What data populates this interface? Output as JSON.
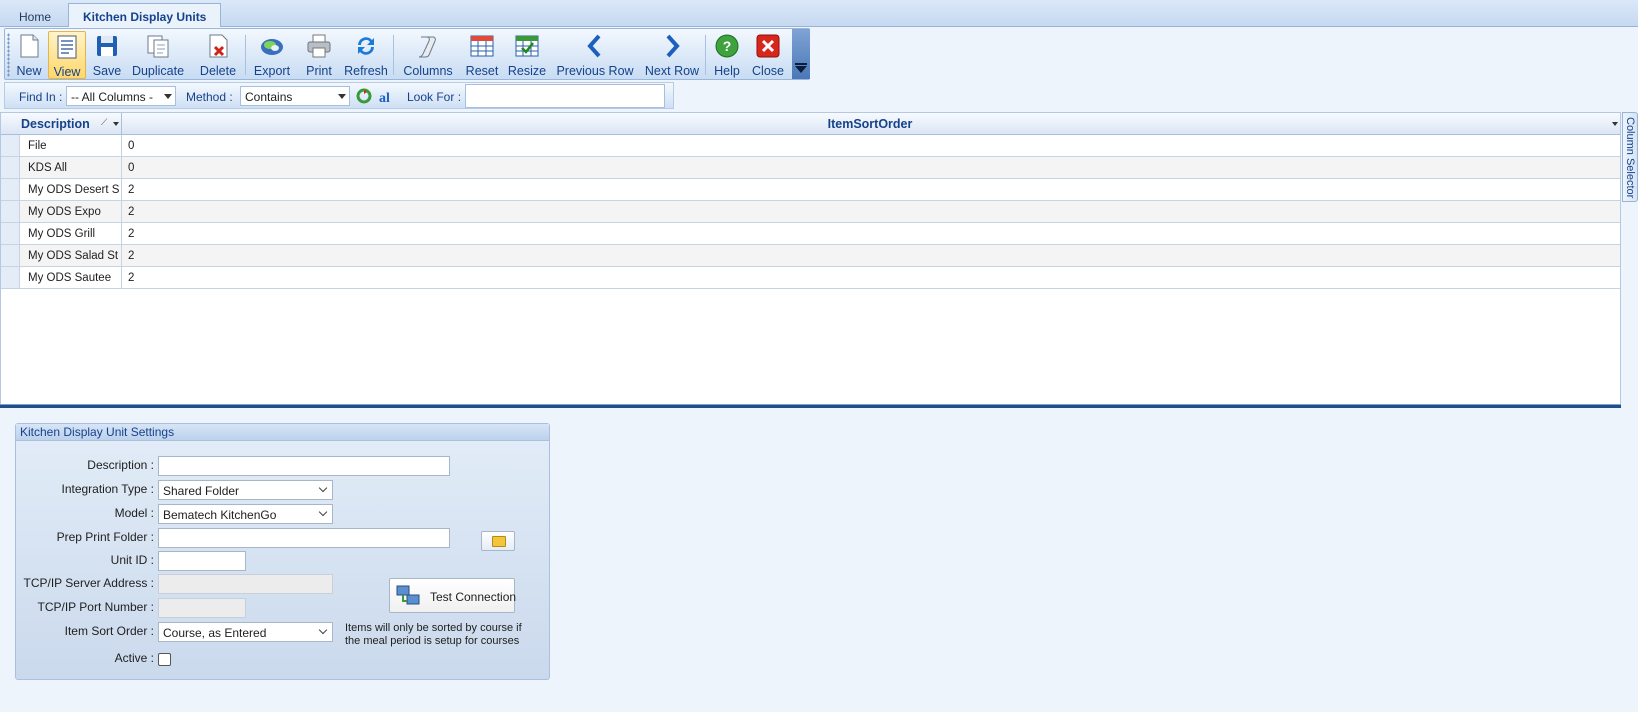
{
  "tabs": [
    {
      "label": "Home"
    },
    {
      "label": "Kitchen Display Units"
    }
  ],
  "toolbar": {
    "new": "New",
    "view": "View",
    "save": "Save",
    "duplicate": "Duplicate",
    "delete": "Delete",
    "export": "Export",
    "print": "Print",
    "refresh": "Refresh",
    "columns": "Columns",
    "reset": "Reset",
    "resize": "Resize",
    "previous_row": "Previous Row",
    "next_row": "Next Row",
    "help": "Help",
    "close": "Close"
  },
  "find": {
    "find_in_label": "Find In :",
    "find_in_value": "-- All Columns -",
    "method_label": "Method :",
    "method_value": "Contains",
    "look_for_label": "Look For :",
    "look_for_value": ""
  },
  "grid": {
    "columns": [
      "Description",
      "ItemSortOrder"
    ],
    "rows": [
      {
        "description": "File",
        "sort": "0"
      },
      {
        "description": "KDS All",
        "sort": "0"
      },
      {
        "description": "My ODS Desert S",
        "sort": "2"
      },
      {
        "description": "My ODS Expo",
        "sort": "2"
      },
      {
        "description": "My ODS Grill",
        "sort": "2"
      },
      {
        "description": "My ODS Salad St",
        "sort": "2"
      },
      {
        "description": "My ODS Sautee",
        "sort": "2"
      }
    ]
  },
  "column_selector": "Column Selector",
  "settings": {
    "title": "Kitchen Display Unit Settings",
    "description_label": "Description :",
    "description_value": "",
    "integration_type_label": "Integration Type :",
    "integration_type_value": "Shared Folder",
    "model_label": "Model :",
    "model_value": "Bematech KitchenGo",
    "prep_print_folder_label": "Prep Print Folder :",
    "prep_print_folder_value": "",
    "unit_id_label": "Unit ID :",
    "unit_id_value": "",
    "tcp_server_label": "TCP/IP Server Address :",
    "tcp_port_label": "TCP/IP Port Number :",
    "item_sort_order_label": "Item Sort Order :",
    "item_sort_order_value": "Course, as Entered",
    "active_label": "Active :",
    "active_checked": false,
    "test_connection": "Test Connection",
    "note": "Items will only be sorted by course if the meal period is setup for courses"
  },
  "colors": {
    "accent": "#15428b",
    "toolbar_bg": "#c8dcf3",
    "selected_button": "#ffd76b"
  }
}
